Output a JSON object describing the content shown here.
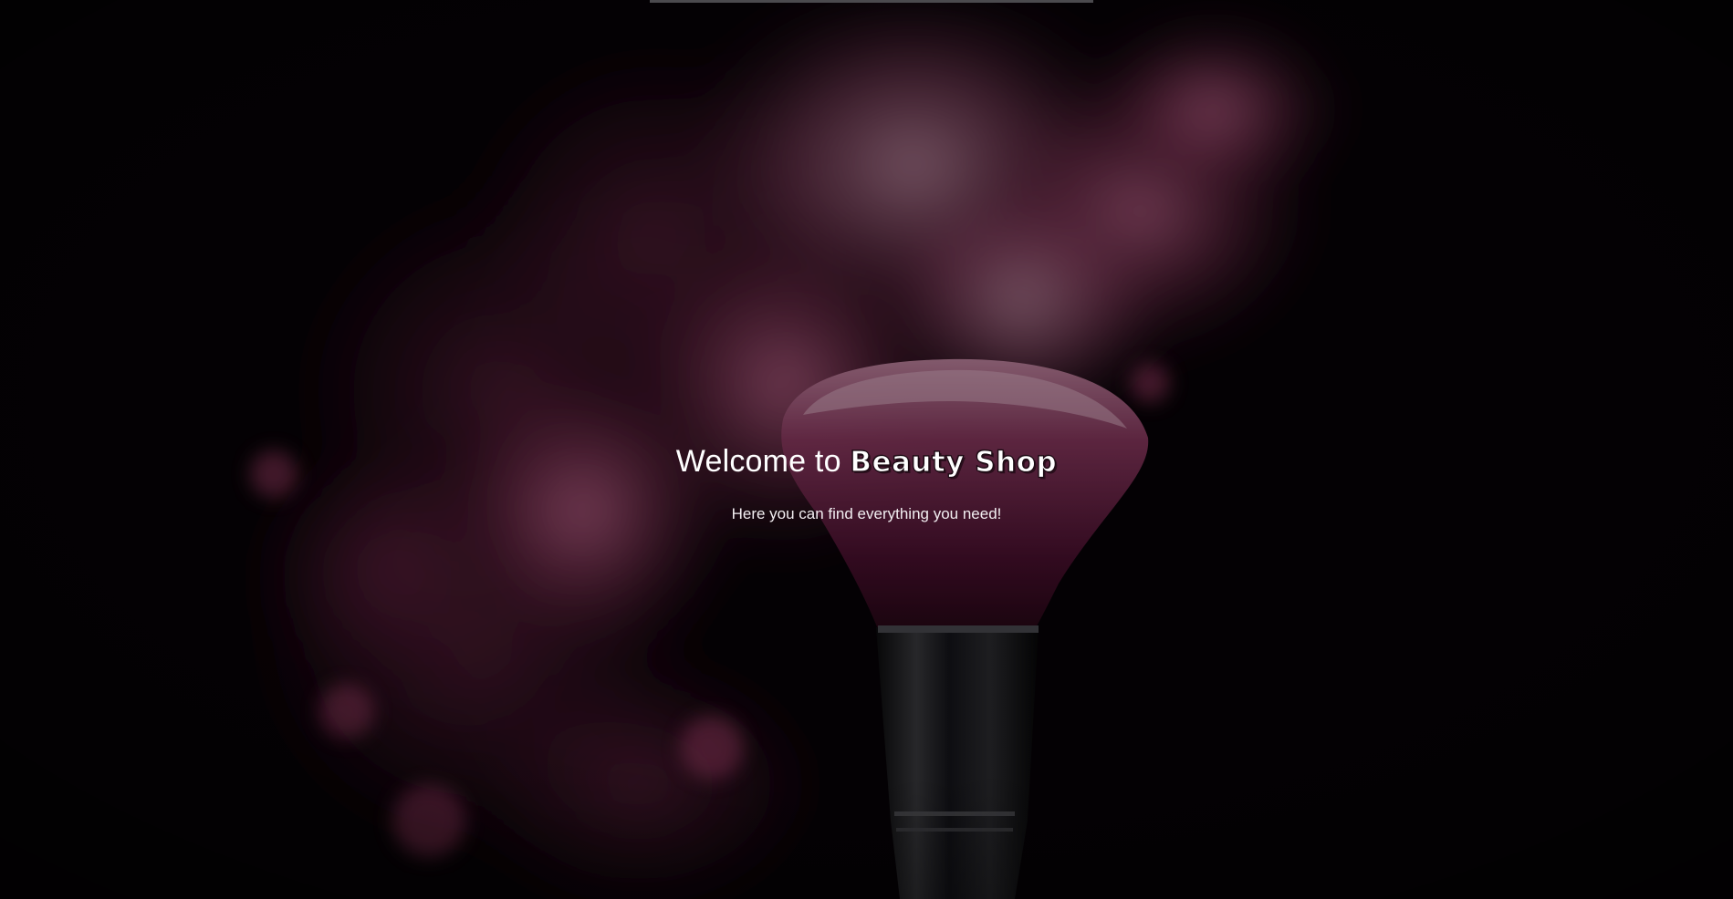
{
  "hero": {
    "headline_prefix": "Welcome to ",
    "brand_name": "Beauty Shop",
    "subtitle": "Here you can find everything you need!"
  },
  "background": {
    "image_subject": "makeup-brush-with-pink-powder-cloud",
    "colors": {
      "base": "#050104",
      "powder": "#b4426f",
      "powder_light": "#d98cae",
      "brush_handle": "#1a1a1c"
    }
  }
}
